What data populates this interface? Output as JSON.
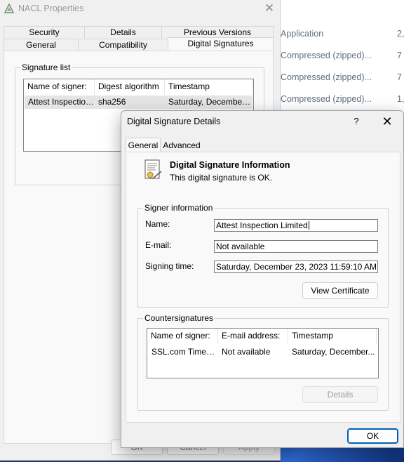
{
  "explorer": {
    "rows": [
      {
        "type": "Application",
        "size": "2,"
      },
      {
        "type": "Compressed (zipped)...",
        "size": "7"
      },
      {
        "type": "Compressed (zipped)...",
        "size": "7"
      },
      {
        "type": "Compressed (zipped)...",
        "size": "1,"
      }
    ]
  },
  "props": {
    "title": "NACL Properties",
    "close_glyph": "✕",
    "tabs_top": [
      "Security",
      "Details",
      "Previous Versions"
    ],
    "tabs_bottom": [
      "General",
      "Compatibility",
      "Digital Signatures"
    ],
    "signature_list": {
      "legend": "Signature list",
      "columns": [
        "Name of signer:",
        "Digest algorithm",
        "Timestamp"
      ],
      "rows": [
        [
          "Attest Inspection ...",
          "sha256",
          "Saturday, December ..."
        ]
      ]
    },
    "buttons": {
      "ok": "OK",
      "cancel": "Cancel",
      "apply": "Apply"
    }
  },
  "dialog": {
    "title": "Digital Signature Details",
    "help_glyph": "?",
    "close_glyph": "✕",
    "tabs": [
      "General",
      "Advanced"
    ],
    "info": {
      "heading": "Digital Signature Information",
      "status": "This digital signature is OK."
    },
    "signer": {
      "legend": "Signer information",
      "name_label": "Name:",
      "name_value": "Attest Inspection Limited",
      "email_label": "E-mail:",
      "email_value": "Not available",
      "signing_time_label": "Signing time:",
      "signing_time_value": "Saturday, December 23, 2023 11:59:10 AM",
      "view_certificate": "View Certificate"
    },
    "countersignatures": {
      "legend": "Countersignatures",
      "columns": [
        "Name of signer:",
        "E-mail address:",
        "Timestamp"
      ],
      "rows": [
        [
          "SSL.com Timesta...",
          "Not available",
          "Saturday, December..."
        ]
      ],
      "details_button": "Details"
    },
    "ok_button": "OK"
  }
}
